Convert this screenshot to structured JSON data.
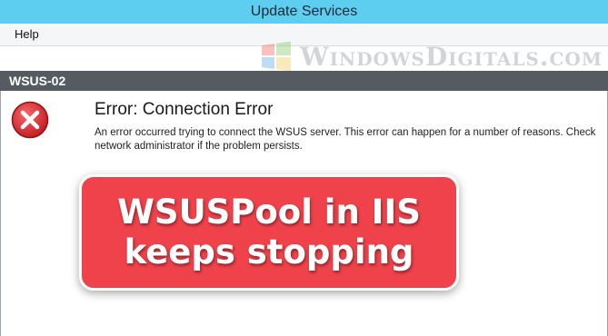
{
  "window": {
    "title": "Update Services"
  },
  "menu": {
    "items": [
      "Help"
    ]
  },
  "watermark": {
    "text": "WindowsDigitals.com"
  },
  "node": {
    "name": "WSUS-02"
  },
  "error": {
    "title": "Error: Connection Error",
    "line1": "An error occurred trying to connect the WSUS server. This error can happen for a number of reasons. Check",
    "line2": "network administrator if the problem persists."
  },
  "banner": {
    "line1": "WSUSPool in IIS",
    "line2": "keeps stopping"
  },
  "colors": {
    "titlebar": "#5dcdf0",
    "header": "#555b61",
    "banner": "#f0424a",
    "error_icon": "#d9262c"
  },
  "icons": {
    "error": "error-x-icon",
    "logo": "windows-logo-icon"
  }
}
